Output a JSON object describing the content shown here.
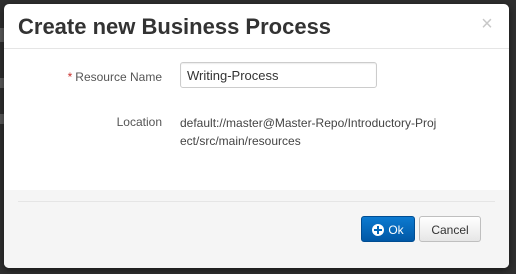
{
  "dialog": {
    "title": "Create new Business Process",
    "close_glyph": "×"
  },
  "form": {
    "required_marker": "*",
    "resource_name": {
      "label": "Resource Name",
      "value": "Writing-Process"
    },
    "location": {
      "label": "Location",
      "value": "default://master@Master-Repo/Introductory-Project/src/main/resources"
    }
  },
  "footer": {
    "ok_label": "Ok",
    "ok_icon": "plus-circle-icon",
    "cancel_label": "Cancel"
  },
  "colors": {
    "primary": "#0066b8",
    "required": "#c9302c"
  }
}
